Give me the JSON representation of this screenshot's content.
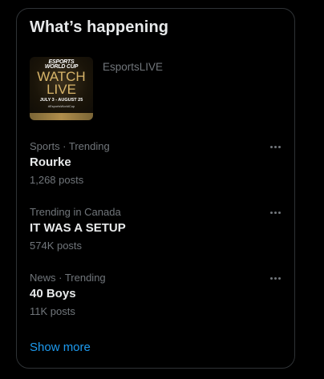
{
  "widget": {
    "title": "What’s happening",
    "promoted": {
      "name": "EsportsLIVE",
      "thumbnail": {
        "logo_line1": "ESPORTS",
        "logo_line2": "WORLD CUP",
        "headline_line1": "WATCH",
        "headline_line2": "LIVE",
        "dates": "JULY 3 - AUGUST 25",
        "hashtag": "#EsportsWorldCup"
      }
    },
    "trends": [
      {
        "meta": "Sports · Trending",
        "name": "Rourke",
        "count": "1,268 posts"
      },
      {
        "meta": "Trending in Canada",
        "name": "IT WAS A SETUP",
        "count": "574K posts"
      },
      {
        "meta": "News · Trending",
        "name": "40 Boys",
        "count": "11K posts"
      }
    ],
    "show_more_label": "Show more"
  },
  "icons": {
    "more": "more-horizontal-icon"
  },
  "colors": {
    "background": "#000000",
    "border": "#2f3336",
    "primary_text": "#e7e9ea",
    "secondary_text": "#71767b",
    "link": "#1d9bf0"
  }
}
